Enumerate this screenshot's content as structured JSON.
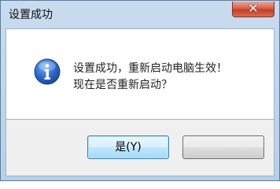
{
  "dialog": {
    "title": "设置成功",
    "close_glyph": "✕",
    "icon": "info-icon",
    "message_line1": "设置成功，重新启动电脑生效！",
    "message_line2": "现在是否重新启动？"
  },
  "buttons": {
    "yes_label": "是(Y)",
    "no_label": ""
  }
}
